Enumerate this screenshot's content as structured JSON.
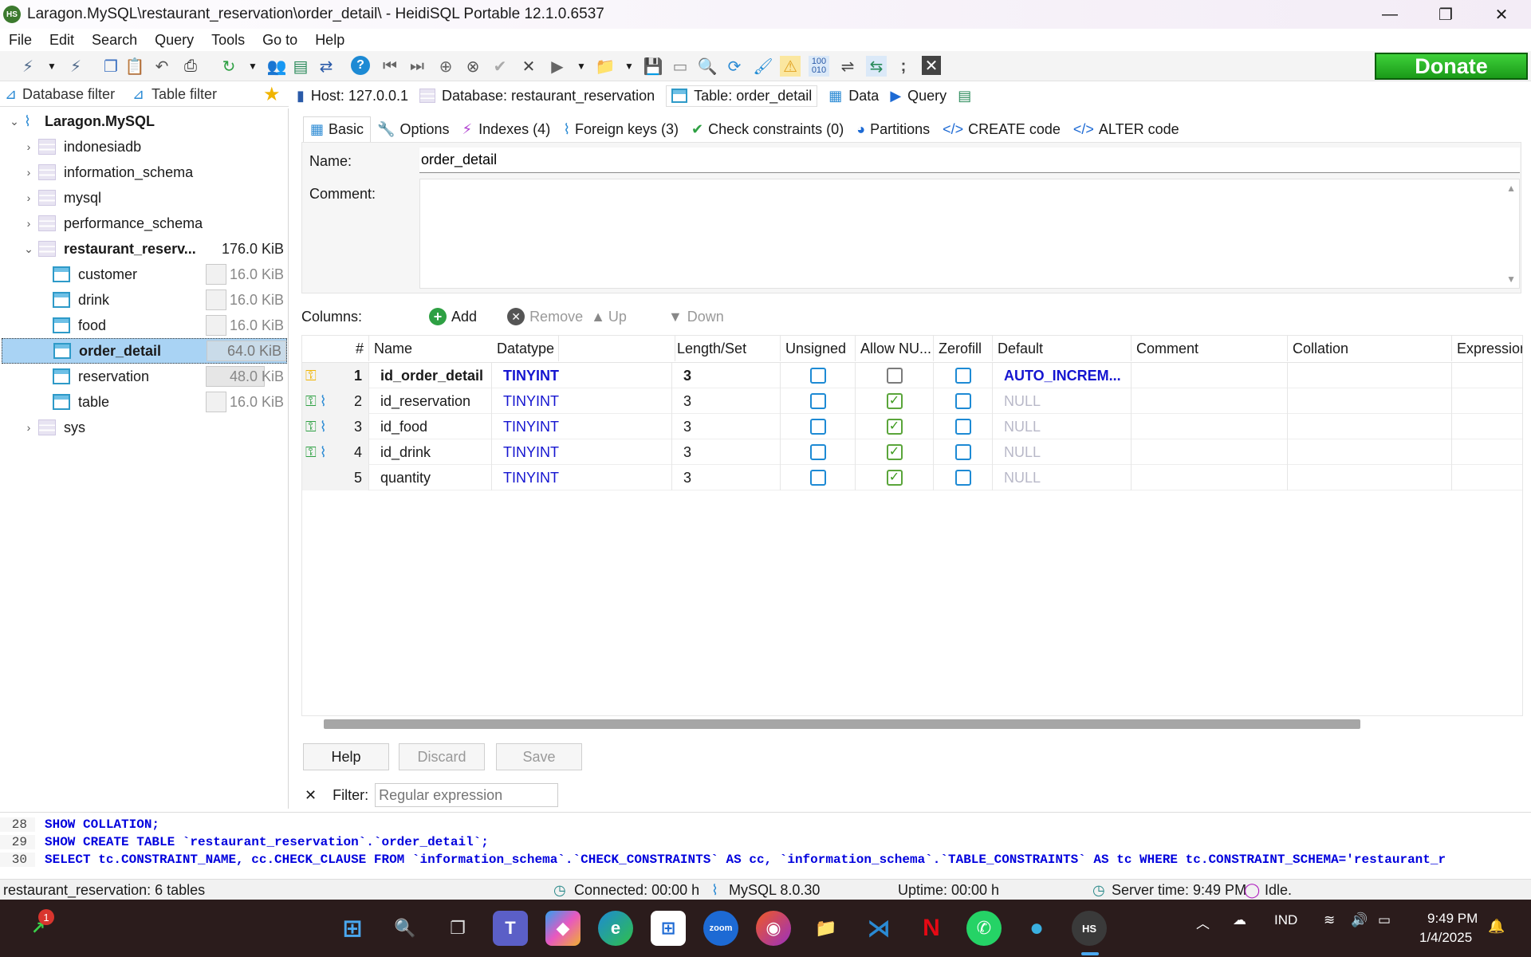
{
  "window": {
    "title": "Laragon.MySQL\\restaurant_reservation\\order_detail\\ - HeidiSQL Portable 12.1.0.6537",
    "app_icon": "HS",
    "minimize": "—",
    "maximize": "❐",
    "close": "✕"
  },
  "menu": [
    "File",
    "Edit",
    "Search",
    "Query",
    "Tools",
    "Go to",
    "Help"
  ],
  "toolbar": {
    "donate": "Donate"
  },
  "filters": {
    "database_filter": "Database filter",
    "table_filter": "Table filter"
  },
  "tree": {
    "root": "Laragon.MySQL",
    "databases": [
      {
        "name": "indonesiadb"
      },
      {
        "name": "information_schema"
      },
      {
        "name": "mysql"
      },
      {
        "name": "performance_schema"
      },
      {
        "name": "restaurant_reserv...",
        "size": "176.0 KiB"
      },
      {
        "name": "sys"
      }
    ],
    "tables": [
      {
        "name": "customer",
        "size": "16.0 KiB"
      },
      {
        "name": "drink",
        "size": "16.0 KiB"
      },
      {
        "name": "food",
        "size": "16.0 KiB"
      },
      {
        "name": "order_detail",
        "size": "64.0 KiB"
      },
      {
        "name": "reservation",
        "size": "48.0 KiB"
      },
      {
        "name": "table",
        "size": "16.0 KiB"
      }
    ]
  },
  "header_tabs": {
    "host": "Host: 127.0.0.1",
    "database": "Database: restaurant_reservation",
    "table": "Table: order_detail",
    "data": "Data",
    "query": "Query"
  },
  "sub_tabs": [
    "Basic",
    "Options",
    "Indexes (4)",
    "Foreign keys (3)",
    "Check constraints (0)",
    "Partitions",
    "CREATE code",
    "ALTER code"
  ],
  "basic": {
    "name_label": "Name:",
    "name_value": "order_detail",
    "comment_label": "Comment:"
  },
  "columns_bar": {
    "label": "Columns:",
    "add": "Add",
    "remove": "Remove",
    "up": "Up",
    "down": "Down"
  },
  "grid": {
    "headers": [
      "#",
      "Name",
      "Datatype",
      "Length/Set",
      "Unsigned",
      "Allow NU...",
      "Zerofill",
      "Default",
      "Comment",
      "Collation",
      "Expression"
    ],
    "rows": [
      {
        "num": "1",
        "name": "id_order_detail",
        "type": "TINYINT",
        "length": "3",
        "unsigned": false,
        "allow_null": false,
        "zerofill": false,
        "default": "AUTO_INCREM...",
        "key": "primary"
      },
      {
        "num": "2",
        "name": "id_reservation",
        "type": "TINYINT",
        "length": "3",
        "unsigned": false,
        "allow_null": true,
        "zerofill": false,
        "default": "NULL",
        "key": "foreign"
      },
      {
        "num": "3",
        "name": "id_food",
        "type": "TINYINT",
        "length": "3",
        "unsigned": false,
        "allow_null": true,
        "zerofill": false,
        "default": "NULL",
        "key": "foreign"
      },
      {
        "num": "4",
        "name": "id_drink",
        "type": "TINYINT",
        "length": "3",
        "unsigned": false,
        "allow_null": true,
        "zerofill": false,
        "default": "NULL",
        "key": "foreign"
      },
      {
        "num": "5",
        "name": "quantity",
        "type": "TINYINT",
        "length": "3",
        "unsigned": false,
        "allow_null": true,
        "zerofill": false,
        "default": "NULL",
        "key": "none"
      }
    ]
  },
  "buttons": {
    "help": "Help",
    "discard": "Discard",
    "save": "Save"
  },
  "filter": {
    "label": "Filter:",
    "placeholder": "Regular expression",
    "close": "✕"
  },
  "sql_log": [
    {
      "ln": "28",
      "text": "SHOW COLLATION;"
    },
    {
      "ln": "29",
      "text": "SHOW CREATE TABLE `restaurant_reservation`.`order_detail`;"
    },
    {
      "ln": "30",
      "text": "SELECT tc.CONSTRAINT_NAME, cc.CHECK_CLAUSE FROM `information_schema`.`CHECK_CONSTRAINTS` AS cc, `information_schema`.`TABLE_CONSTRAINTS` AS tc WHERE tc.CONSTRAINT_SCHEMA='restaurant_r"
    }
  ],
  "status": {
    "tables": "restaurant_reservation: 6 tables",
    "connected": "Connected: 00:00 h",
    "version": "MySQL 8.0.30",
    "uptime": "Uptime: 00:00 h",
    "server_time": "Server time: 9:49 PM",
    "state": "Idle."
  },
  "taskbar": {
    "badge": "1",
    "lang": "IND",
    "time": "9:49 PM",
    "date": "1/4/2025",
    "zoom": "zoom",
    "hs": "HS"
  },
  "colors": {
    "accent": "#1d8ad4",
    "selection": "#a9d3f4",
    "donate": "#22b320",
    "keyword": "#0000dd"
  }
}
